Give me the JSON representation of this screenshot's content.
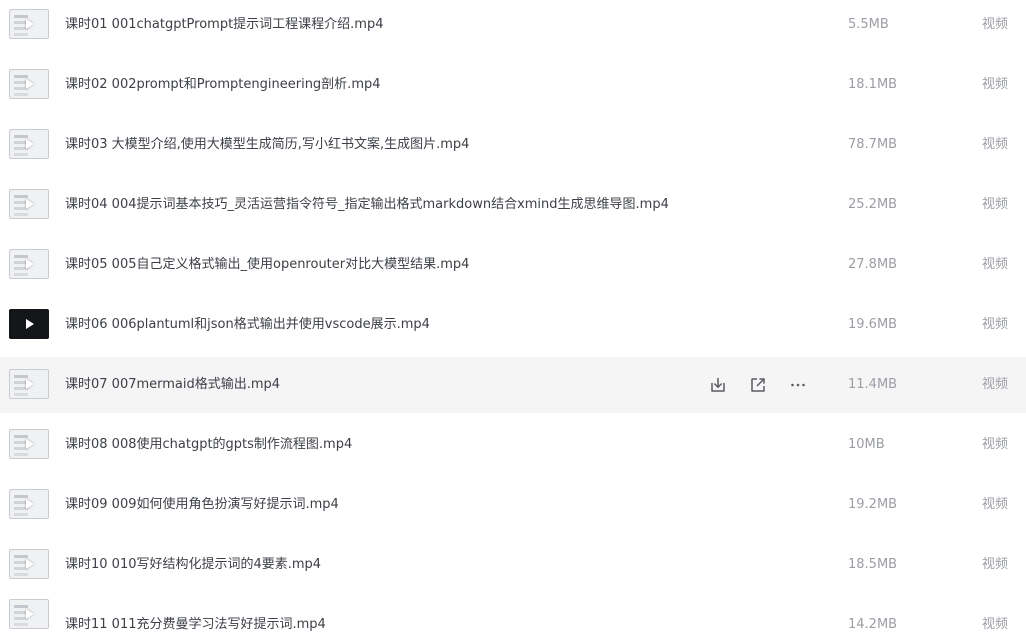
{
  "files": [
    {
      "name": "课时01 001chatgptPrompt提示词工程课程介绍.mp4",
      "size": "5.5MB",
      "type": "视频",
      "thumb": "video-thumbnail-icon"
    },
    {
      "name": "课时02 002prompt和Promptengineering剖析.mp4",
      "size": "18.1MB",
      "type": "视频",
      "thumb": "video-thumbnail-icon"
    },
    {
      "name": "课时03 大模型介绍,使用大模型生成简历,写小红书文案,生成图片.mp4",
      "size": "78.7MB",
      "type": "视频",
      "thumb": "video-thumbnail-icon"
    },
    {
      "name": "课时04 004提示词基本技巧_灵活运营指令符号_指定输出格式markdown结合xmind生成思维导图.mp4",
      "size": "25.2MB",
      "type": "视频",
      "thumb": "video-thumbnail-icon"
    },
    {
      "name": "课时05 005自己定义格式输出_使用openrouter对比大模型结果.mp4",
      "size": "27.8MB",
      "type": "视频",
      "thumb": "video-thumbnail-icon"
    },
    {
      "name": "课时06 006plantuml和json格式输出并使用vscode展示.mp4",
      "size": "19.6MB",
      "type": "视频",
      "thumb": "video-thumbnail-dark-icon"
    },
    {
      "name": "课时07 007mermaid格式输出.mp4",
      "size": "11.4MB",
      "type": "视频",
      "thumb": "video-thumbnail-icon"
    },
    {
      "name": "课时08 008使用chatgpt的gpts制作流程图.mp4",
      "size": "10MB",
      "type": "视频",
      "thumb": "video-thumbnail-icon"
    },
    {
      "name": "课时09 009如何使用角色扮演写好提示词.mp4",
      "size": "19.2MB",
      "type": "视频",
      "thumb": "video-thumbnail-icon"
    },
    {
      "name": "课时10 010写好结构化提示词的4要素.mp4",
      "size": "18.5MB",
      "type": "视频",
      "thumb": "video-thumbnail-icon"
    },
    {
      "name": "课时11 011充分费曼学习法写好提示词.mp4",
      "size": "14.2MB",
      "type": "视频",
      "thumb": "video-thumbnail-icon"
    }
  ],
  "hover_row_actions": [
    "download-icon",
    "share-icon",
    "more-icon"
  ],
  "colors": {
    "hover_background": "#f5f5f6",
    "name_text": "#3d4047",
    "meta_text": "#9b9ea4",
    "icon": "#5a5d64"
  }
}
